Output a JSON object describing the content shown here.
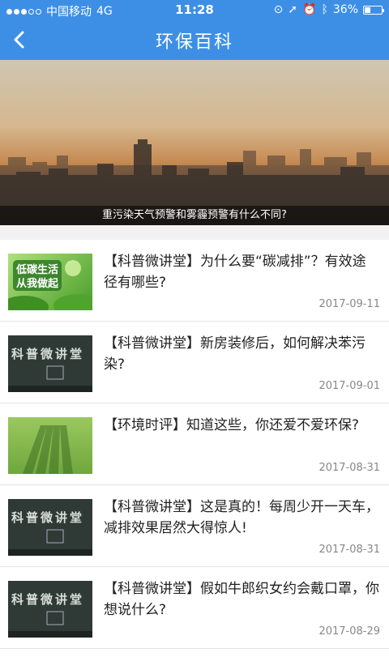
{
  "status_bar": {
    "carrier": "中国移动",
    "network": "4G",
    "time": "11:28",
    "battery": "36%",
    "battery_level": 0.36
  },
  "nav": {
    "title": "环保百科"
  },
  "hero": {
    "caption": "重污染天气预警和雾霾预警有什么不同?"
  },
  "thumb_text": {
    "green": [
      "低碳生活",
      "从我做起"
    ],
    "board": "科普微讲堂"
  },
  "articles": [
    {
      "title": "【科普微讲堂】为什么要“碳减排”？有效途径有哪些?",
      "date": "2017-09-11",
      "thumb": "green"
    },
    {
      "title": "【科普微讲堂】新房装修后，如何解决苯污染?",
      "date": "2017-09-01",
      "thumb": "board"
    },
    {
      "title": "【环境时评】知道这些，你还爱不爱环保?",
      "date": "2017-08-31",
      "thumb": "grass"
    },
    {
      "title": "【科普微讲堂】这是真的！每周少开一天车，减排效果居然大得惊人!",
      "date": "2017-08-31",
      "thumb": "board"
    },
    {
      "title": "【科普微讲堂】假如牛郎织女约会戴口罩，你想说什么?",
      "date": "2017-08-29",
      "thumb": "board"
    }
  ]
}
